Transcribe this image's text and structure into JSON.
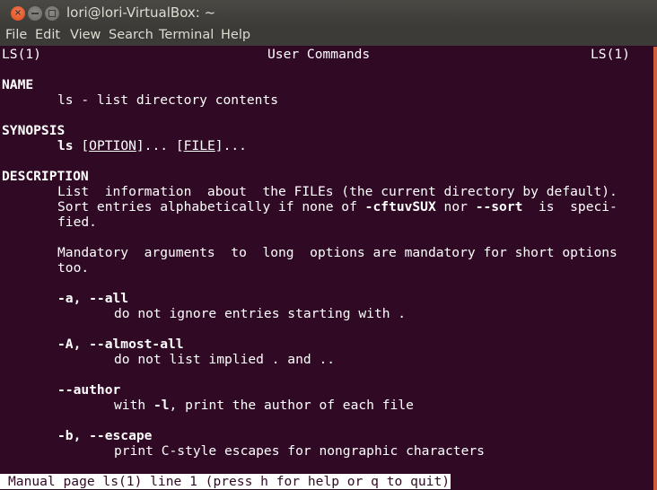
{
  "window": {
    "title": "lori@lori-VirtualBox: ~",
    "controls": [
      "close",
      "minimize",
      "maximize"
    ]
  },
  "menubar": {
    "items": [
      "File",
      "Edit",
      "View",
      "Search",
      "Terminal",
      "Help"
    ]
  },
  "colors": {
    "terminal_bg": "#300a24",
    "terminal_fg": "#ffffff",
    "scrollbar": "#cd5c3c",
    "close_button": "#df4a16"
  },
  "manpage": {
    "header_left": "LS(1)",
    "header_center": "User Commands",
    "header_right": "LS(1)",
    "name_heading": "NAME",
    "name_text": "ls - list directory contents",
    "synopsis_heading": "SYNOPSIS",
    "synopsis_cmd": "ls",
    "synopsis_open1": "[",
    "synopsis_option": "OPTION",
    "synopsis_close1": "]... ",
    "synopsis_open2": "[",
    "synopsis_file": "FILE",
    "synopsis_close2": "]...",
    "description_heading": "DESCRIPTION",
    "desc_line1": "List  information  about  the FILEs (the current directory by default).",
    "desc_line2_a": "Sort entries alphabetically if none of ",
    "desc_line2_b": "-cftuvSUX",
    "desc_line2_c": " nor ",
    "desc_line2_d": "--sort",
    "desc_line2_e": "  is  speci-",
    "desc_line3": "fied.",
    "desc_line4": "Mandatory  arguments  to  long  options are mandatory for short options",
    "desc_line5": "too.",
    "options": [
      {
        "flag": "-a, --all",
        "desc": "do not ignore entries starting with ."
      },
      {
        "flag": "-A, --almost-all",
        "desc": "do not list implied . and .."
      },
      {
        "flag": "--author",
        "desc_a": "with ",
        "desc_b": "-l",
        "desc_c": ", print the author of each file"
      },
      {
        "flag": "-b, --escape",
        "desc": "print C-style escapes for nongraphic characters"
      }
    ],
    "status_line": "Manual page ls(1) line 1 (press h for help or q to quit)"
  }
}
